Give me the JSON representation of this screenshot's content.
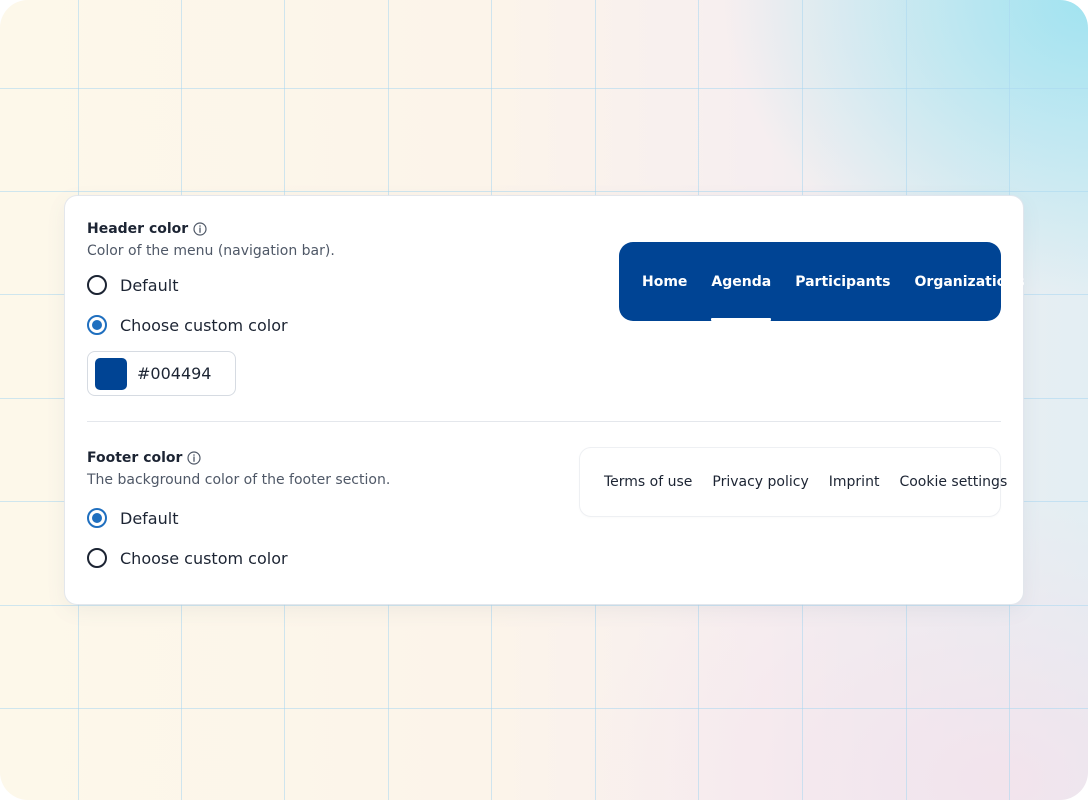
{
  "colors": {
    "custom_header": "#004494",
    "radio_selected": "#1f6fbf"
  },
  "header_section": {
    "title": "Header color",
    "title_icon": "info-icon",
    "description": "Color of the menu (navigation bar).",
    "options": [
      {
        "label": "Default",
        "checked": false
      },
      {
        "label": "Choose custom color",
        "checked": true
      }
    ],
    "color_value": "#004494",
    "preview_nav": [
      {
        "label": "Home",
        "active": false
      },
      {
        "label": "Agenda",
        "active": true
      },
      {
        "label": "Participants",
        "active": false
      },
      {
        "label": "Organizations",
        "active": false
      }
    ]
  },
  "footer_section": {
    "title": "Footer color",
    "title_icon": "info-icon",
    "description": "The background color of the footer section.",
    "options": [
      {
        "label": "Default",
        "checked": true
      },
      {
        "label": "Choose custom color",
        "checked": false
      }
    ],
    "preview_links": [
      {
        "label": "Terms of use"
      },
      {
        "label": "Privacy policy"
      },
      {
        "label": "Imprint"
      },
      {
        "label": "Cookie settings"
      }
    ]
  }
}
